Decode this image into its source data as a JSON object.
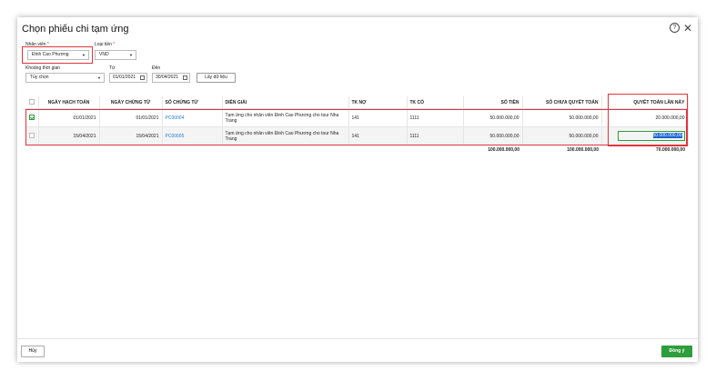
{
  "dialog": {
    "title": "Chọn phiếu chi tạm ứng"
  },
  "filters": {
    "employee_label": "Nhân viên",
    "employee_value": "Đinh Cao Phương",
    "currency_label": "Loại tiền",
    "currency_value": "VND",
    "period_label": "Khoảng thời gian",
    "period_value": "Tùy chọn",
    "from_label": "Từ",
    "from_value": "01/01/2021",
    "to_label": "Đến",
    "to_value": "30/04/2021",
    "fetch_button": "Lấy dữ liệu"
  },
  "table": {
    "headers": [
      "NGÀY HẠCH TOÁN",
      "NGÀY CHỨNG TỪ",
      "SỐ CHỨNG TỪ",
      "DIỄN GIẢI",
      "TK NỢ",
      "TK CÓ",
      "SỐ TIỀN",
      "SỐ CHƯA QUYẾT TOÁN",
      "QUYẾT TOÁN LẦN NÀY"
    ],
    "rows": [
      {
        "checked": true,
        "posting_date": "01/01/2021",
        "doc_date": "01/01/2021",
        "doc_no": "PC00004",
        "description": "Tạm ứng cho nhân viên Đinh Cao Phương cho tour Nha Trang",
        "debit": "141",
        "credit": "1111",
        "amount": "50.000.000,00",
        "unsettled": "50.000.000,00",
        "settle_now": "20.000.000,00"
      },
      {
        "checked": false,
        "posting_date": "15/04/2021",
        "doc_date": "15/04/2021",
        "doc_no": "PC00005",
        "description": "Tạm ứng cho nhân viên Đinh Cao Phương cho tour Nha Trang",
        "debit": "141",
        "credit": "1111",
        "amount": "50.000.000,00",
        "unsettled": "50.000.000,00",
        "settle_now": "50.000.000,00"
      }
    ],
    "totals": {
      "amount": "100.000.000,00",
      "unsettled": "100.000.000,00",
      "settle_now": "70.000.000,00"
    }
  },
  "footer": {
    "cancel": "Hủy",
    "ok": "Đồng ý"
  },
  "icons": {
    "help": "help-icon",
    "close": "close-icon",
    "calendar": "calendar-icon",
    "dropdown": "chevron-down-icon"
  },
  "colors": {
    "accent": "#2c9e3b",
    "link": "#1f7ad0",
    "highlight": "#e0353f",
    "selection": "#1a66d1"
  }
}
